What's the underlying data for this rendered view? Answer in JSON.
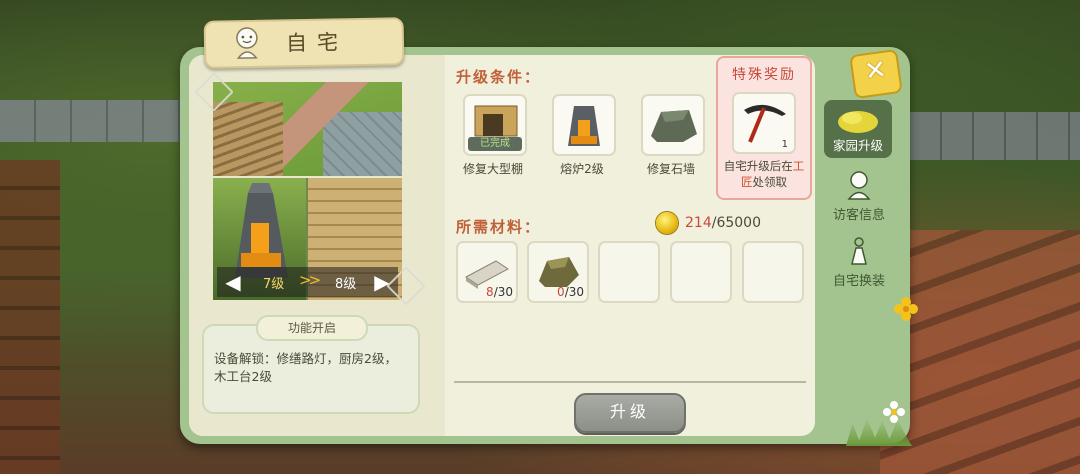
{
  "header": {
    "title": "自宅"
  },
  "preview": {
    "current_level": "7级",
    "next_level": "8级",
    "level_chevrons": ">>"
  },
  "unlock": {
    "label": "功能开启",
    "text": "设备解锁：修缮路灯，厨房2级，木工台2级"
  },
  "conditions": {
    "title": "升级条件：",
    "items": [
      {
        "label": "修复大型棚",
        "status": "已完成",
        "icon": "shed-icon"
      },
      {
        "label": "熔炉2级",
        "icon": "furnace-icon"
      },
      {
        "label": "修复石墙",
        "icon": "stone-wall-icon"
      }
    ]
  },
  "reward": {
    "title": "特殊奖励",
    "count": "1",
    "icon": "pickaxe-icon",
    "text_before": "自宅升级后在",
    "text_highlight": "工匠",
    "text_after": "处领取"
  },
  "materials": {
    "title": "所需材料：",
    "coin_current": "214",
    "coin_separator": "/",
    "coin_required": "65000",
    "items": [
      {
        "icon": "stone-slab-icon",
        "current": "8",
        "required": "/30"
      },
      {
        "icon": "ore-icon",
        "current": "0",
        "required": "/30"
      }
    ],
    "empty_slots": 3
  },
  "actions": {
    "upgrade_label": "升级"
  },
  "sidebar": {
    "items": [
      {
        "label": "家园升级",
        "icon": "fields-icon",
        "active": true
      },
      {
        "label": "访客信息",
        "icon": "visitor-icon",
        "active": false
      },
      {
        "label": "自宅换装",
        "icon": "dress-up-icon",
        "active": false
      }
    ]
  },
  "colors": {
    "panel_border": "#a3c48e",
    "panel_bg": "#f1f0dd",
    "section_title": "#c0613a",
    "highlight_red": "#d0453a",
    "active_tab": "#56704a"
  }
}
